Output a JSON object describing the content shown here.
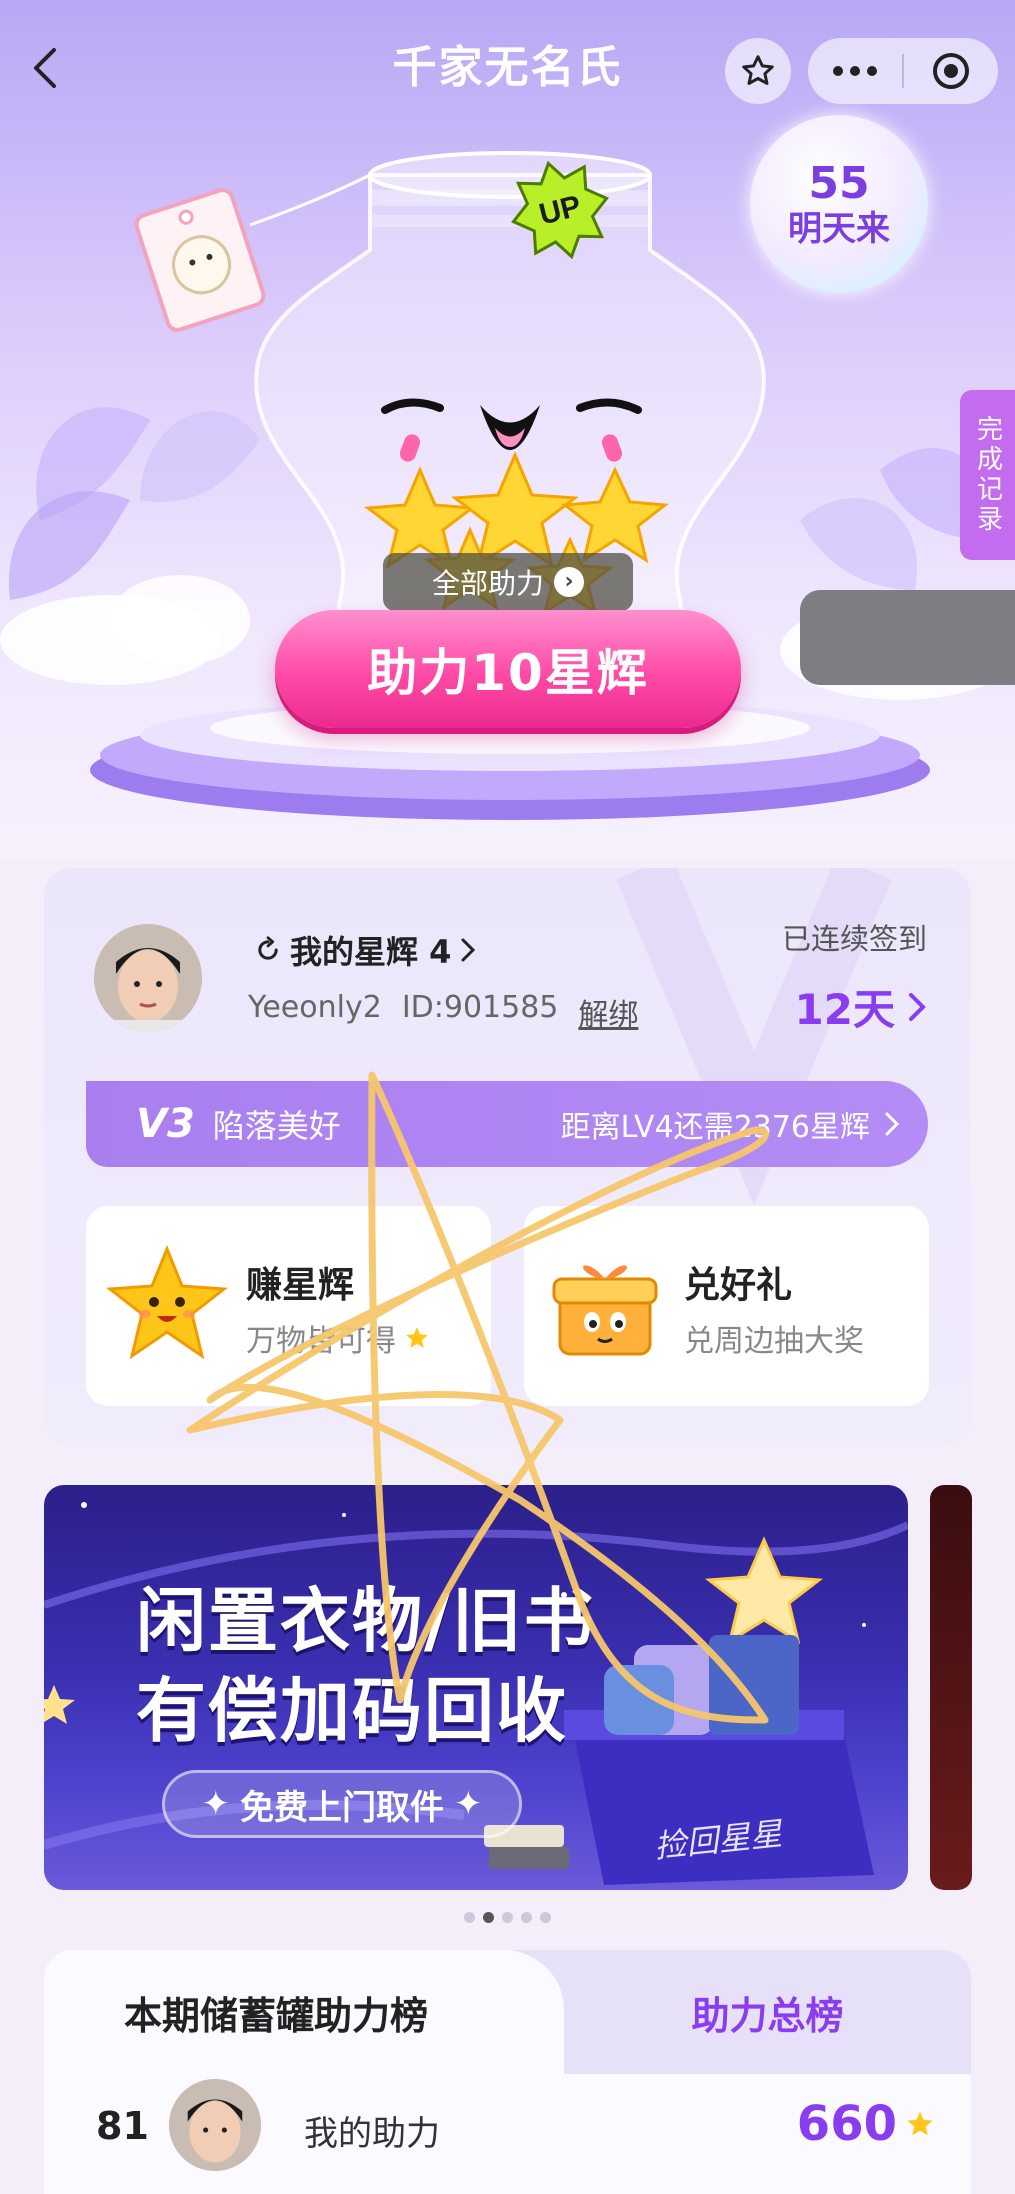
{
  "nav": {
    "title": "千家无名氏",
    "icons": [
      "back-arrow-icon",
      "star-icon",
      "more-dots-icon",
      "target-circle-icon"
    ]
  },
  "hero": {
    "countdown": {
      "number": "55",
      "text": "明天来"
    },
    "side_tag": "完成记录",
    "jar_badge": "UP",
    "all_help_label": "全部助力",
    "main_button": "助力10星辉"
  },
  "profile": {
    "my_stars_label": "我的星辉 4",
    "username": "Yeeonly2",
    "user_id": "ID:901585",
    "unbind_label": "解绑",
    "checkin_label": "已连续签到",
    "checkin_days": "12天"
  },
  "level": {
    "badge": "V3",
    "name": "陷落美好",
    "next_level": "距离LV4还需2376星辉"
  },
  "tiles": {
    "earn": {
      "title": "赚星辉",
      "subtitle": "万物皆可得"
    },
    "redeem": {
      "title": "兑好礼",
      "subtitle": "兑周边抽大奖"
    }
  },
  "banner": {
    "line1": "闲置衣物/旧书",
    "line2": "有偿加码回收",
    "pill": "免费上门取件",
    "box_label": "捡回星星",
    "dots_total": 5,
    "dots_active": 1
  },
  "ranking": {
    "tab_current": "本期储蓄罐助力榜",
    "tab_total": "助力总榜",
    "my_rank": "81",
    "my_label": "我的助力",
    "my_score": "660"
  },
  "colors": {
    "accent_purple": "#8a3df0",
    "cta_pink": "#ff4aa6",
    "doodle_yellow": "#f5c66b"
  }
}
